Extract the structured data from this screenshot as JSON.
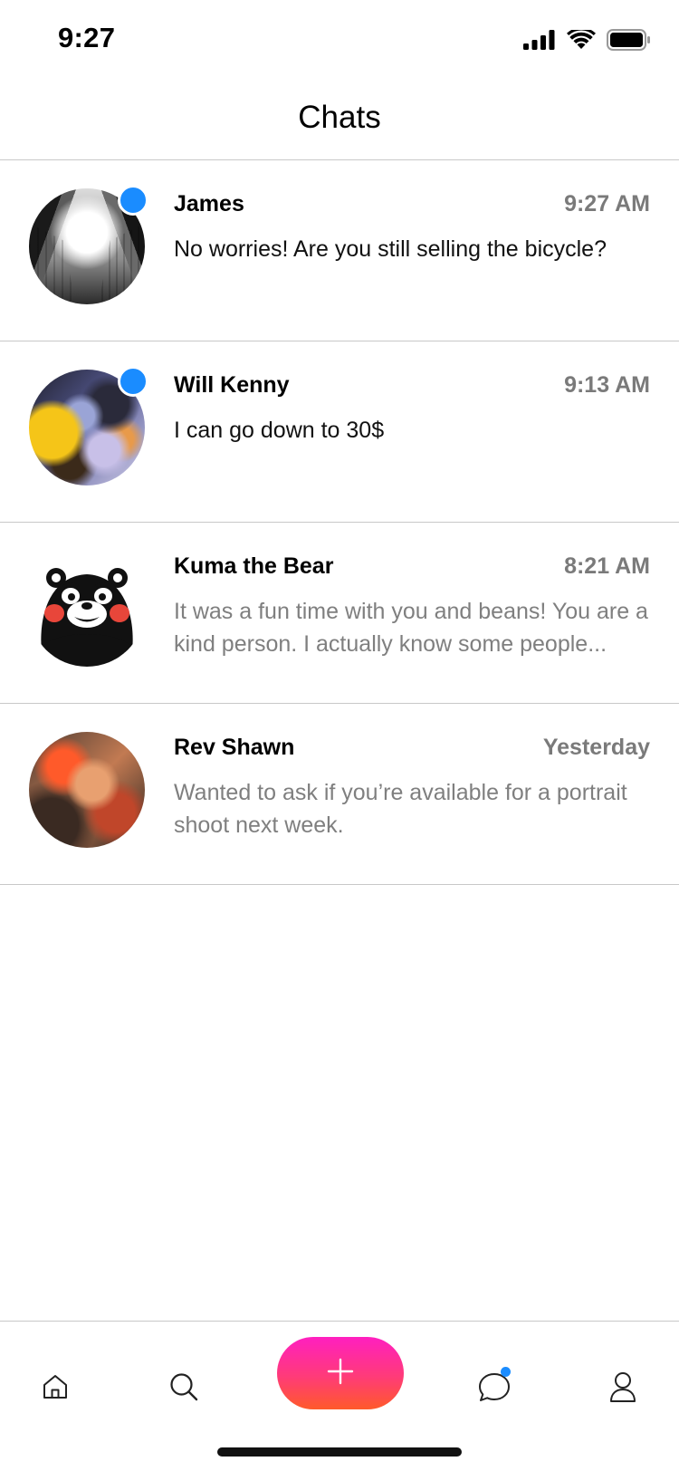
{
  "status_bar": {
    "time": "9:27",
    "icons": [
      "cellular-signal-icon",
      "wifi-icon",
      "battery-icon"
    ]
  },
  "header": {
    "title": "Chats"
  },
  "chats": [
    {
      "name": "James",
      "time": "9:27 AM",
      "message": "No worries! Are you still selling the bicycle?",
      "unread": true,
      "avatar": "skyscrapers-photo"
    },
    {
      "name": "Will Kenny",
      "time": "9:13 AM",
      "message": "I can go down to 30$",
      "unread": true,
      "avatar": "abstract-paint-photo"
    },
    {
      "name": "Kuma the Bear",
      "time": "8:21 AM",
      "message": "It was a fun time with you and beans! You are a kind person. I actually know some people...",
      "unread": false,
      "avatar": "kumamon-bear-illustration"
    },
    {
      "name": "Rev Shawn",
      "time": "Yesterday",
      "message": "Wanted to ask if you’re available for a portrait shoot next week.",
      "unread": false,
      "avatar": "woman-red-hair-photo"
    }
  ],
  "tab_bar": {
    "items": [
      "home-icon",
      "search-icon",
      "plus-icon",
      "chat-bubble-icon",
      "person-icon"
    ],
    "active": "chat-bubble-icon"
  },
  "colors": {
    "accent_blue": "#1a8cff",
    "fab_gradient_top": "#ff1fc0",
    "fab_gradient_bottom": "#ff5a2a",
    "divider": "#c8c8c8",
    "muted_text": "#7f7f7f"
  }
}
